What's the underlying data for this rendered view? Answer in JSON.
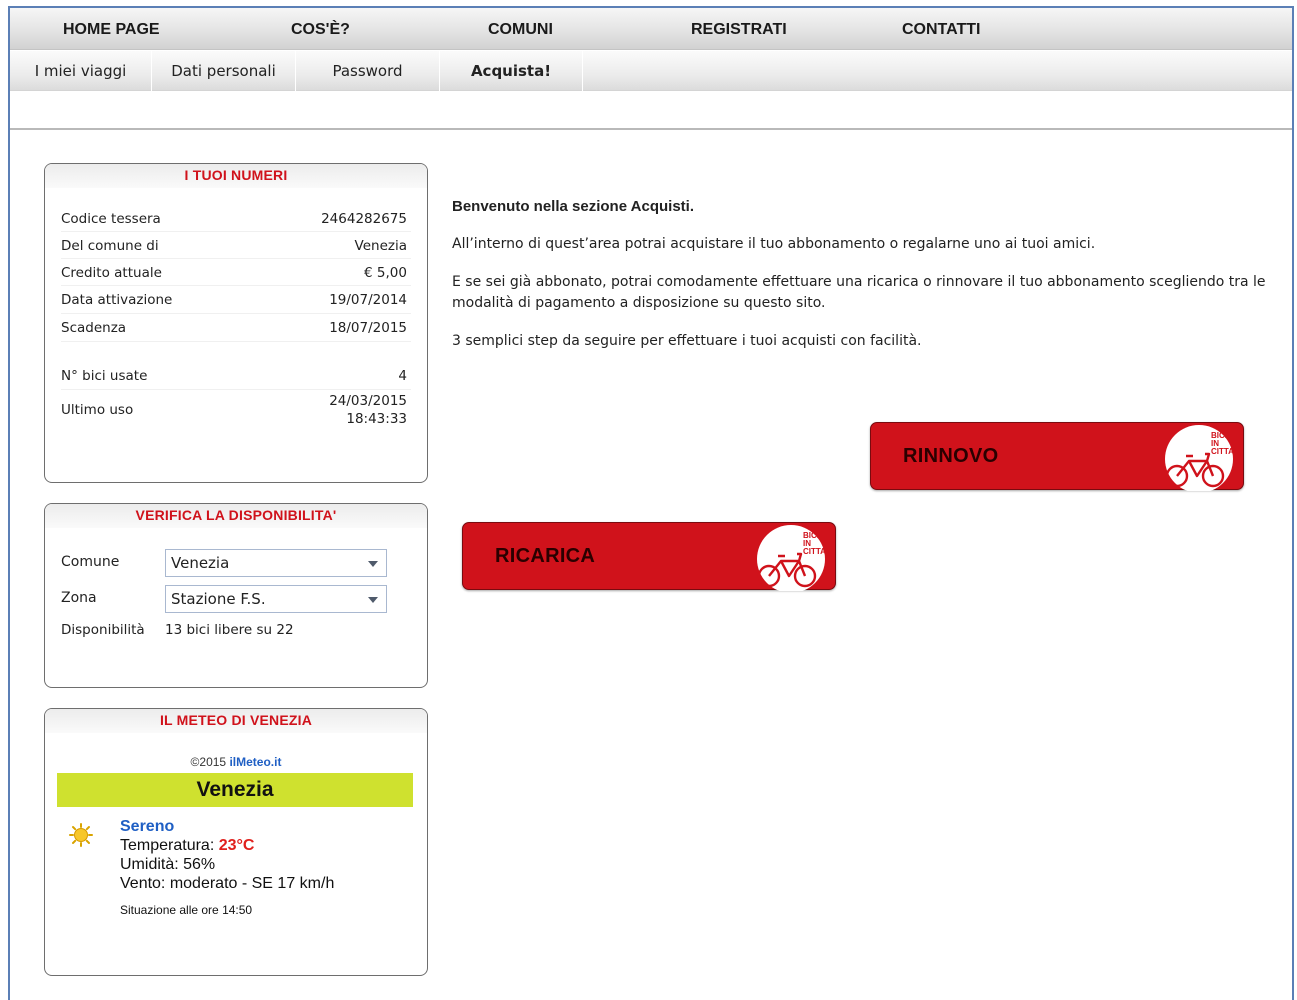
{
  "main_nav": [
    "HOME PAGE",
    "COS'È?",
    "COMUNI",
    "REGISTRATI",
    "CONTATTI"
  ],
  "sub_nav": [
    {
      "label": "I miei viaggi"
    },
    {
      "label": "Dati personali"
    },
    {
      "label": "Password"
    },
    {
      "label": "Acquista!",
      "active": true
    }
  ],
  "numeri": {
    "title": "I TUOI NUMERI",
    "rows": [
      {
        "label": "Codice tessera",
        "value": "2464282675"
      },
      {
        "label": "Del comune di",
        "value": "Venezia"
      },
      {
        "label": "Credito attuale",
        "value": "€ 5,00"
      },
      {
        "label": "Data attivazione",
        "value": "19/07/2014"
      },
      {
        "label": "Scadenza",
        "value": "18/07/2015"
      }
    ],
    "bici_label": "N° bici usate",
    "bici_value": "4",
    "ultimo_label": "Ultimo uso",
    "ultimo_date": "24/03/2015",
    "ultimo_time": "18:43:33"
  },
  "verifica": {
    "title": "VERIFICA LA DISPONIBILITA'",
    "comune_label": "Comune",
    "comune_value": "Venezia",
    "zona_label": "Zona",
    "zona_value": "Stazione F.S.",
    "disp_label": "Disponibilità",
    "disp_value": "13 bici libere su 22"
  },
  "meteo": {
    "title": "IL METEO DI VENEZIA",
    "copyright": "©2015",
    "provider": "ilMeteo.it",
    "city": "Venezia",
    "condition": "Sereno",
    "temp_label": "Temperatura:",
    "temp_value": "23°C",
    "humidity": "Umidità: 56%",
    "wind": "Vento: moderato - SE 17 km/h",
    "updated": "Situazione alle ore 14:50"
  },
  "content": {
    "welcome": "Benvenuto nella sezione Acquisti.",
    "p1": "All’interno di quest’area potrai acquistare il tuo abbonamento o regalarne uno ai tuoi amici.",
    "p2": "E se sei già abbonato, potrai comodamente effettuare una ricarica o rinnovare il tuo abbonamento scegliendo tra le modalità di pagamento a disposizione su questo sito.",
    "p3": "3 semplici step da seguire per effettuare i tuoi acquisti con facilità."
  },
  "buttons": {
    "rinnovo": "RINNOVO",
    "ricarica": "RICARICA"
  },
  "logo_text": [
    "BICI",
    "IN",
    "CITTA'"
  ],
  "colors": {
    "accent": "#d0121b",
    "meteo_band": "#cfe12f",
    "link": "#1f5fc4",
    "frame": "#5b7fb6"
  }
}
